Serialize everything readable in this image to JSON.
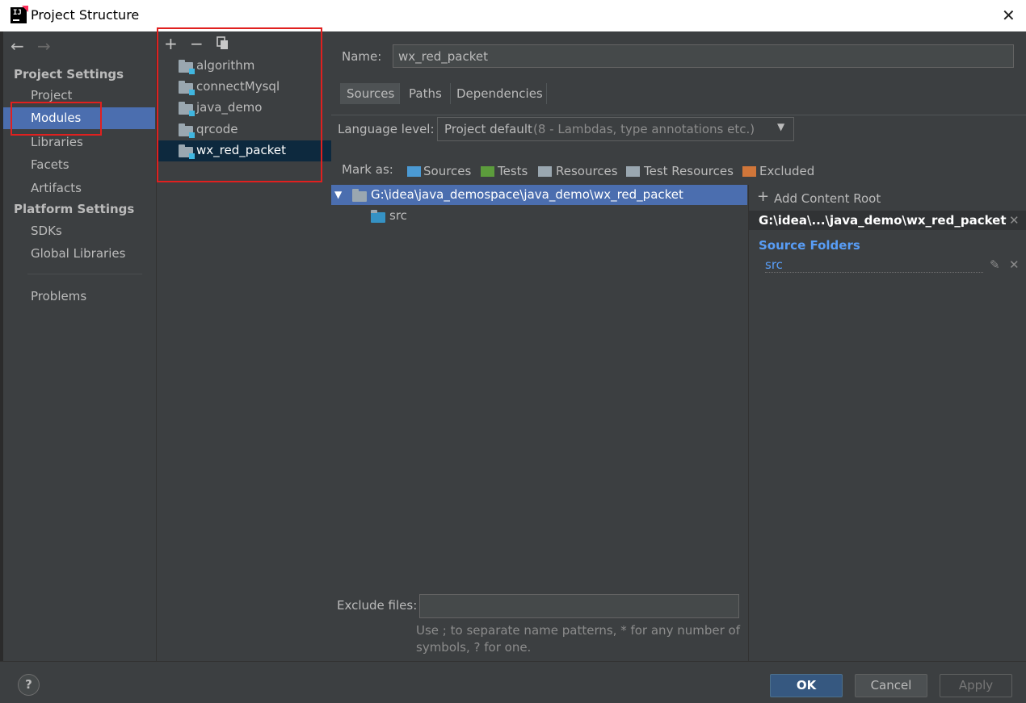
{
  "window": {
    "title": "Project Structure"
  },
  "sidebar": {
    "back_icon": "arrow-left-icon",
    "forward_icon": "arrow-right-icon",
    "project_settings_header": "Project Settings",
    "project_items": [
      "Project",
      "Modules",
      "Libraries",
      "Facets",
      "Artifacts"
    ],
    "platform_settings_header": "Platform Settings",
    "platform_items": [
      "SDKs",
      "Global Libraries"
    ],
    "problems": "Problems",
    "selected": "Modules"
  },
  "modules": {
    "toolbar": {
      "add": "+",
      "remove": "−",
      "copy_icon": "copy-icon"
    },
    "items": [
      "algorithm",
      "connectMysql",
      "java_demo",
      "qrcode",
      "wx_red_packet"
    ],
    "selected": "wx_red_packet"
  },
  "main": {
    "name_label": "Name:",
    "name_value": "wx_red_packet",
    "tabs": [
      "Sources",
      "Paths",
      "Dependencies"
    ],
    "active_tab": "Sources",
    "language_level_label": "Language level:",
    "language_level_value": "Project default",
    "language_level_detail": "(8 - Lambdas, type annotations etc.)",
    "mark_as_label": "Mark as:",
    "mark_as": [
      {
        "label": "Sources",
        "color": "#4b9ad4"
      },
      {
        "label": "Tests",
        "color": "#5c9c3c"
      },
      {
        "label": "Resources",
        "color": "#9aa7b0"
      },
      {
        "label": "Test Resources",
        "color": "#9aa7b0"
      },
      {
        "label": "Excluded",
        "color": "#d0763a"
      }
    ],
    "tree_root": "G:\\idea\\java_demospace\\java_demo\\wx_red_packet",
    "tree_child": "src",
    "exclude_files_label": "Exclude files:",
    "exclude_files_value": "",
    "hint_line1": "Use ; to separate name patterns, * for any number of",
    "hint_line2": "symbols, ? for one."
  },
  "content_root": {
    "add_label": "Add Content Root",
    "path": "G:\\idea\\...\\java_demo\\wx_red_packet",
    "source_folders_header": "Source Folders",
    "source_folder": "src"
  },
  "footer": {
    "help": "?",
    "ok": "OK",
    "cancel": "Cancel",
    "apply": "Apply"
  },
  "colors": {
    "background": "#3c3f41",
    "selection": "#4b6eaf",
    "module_selection": "#0d293e",
    "highlight_box": "#e0201f",
    "link_blue": "#589df6"
  }
}
